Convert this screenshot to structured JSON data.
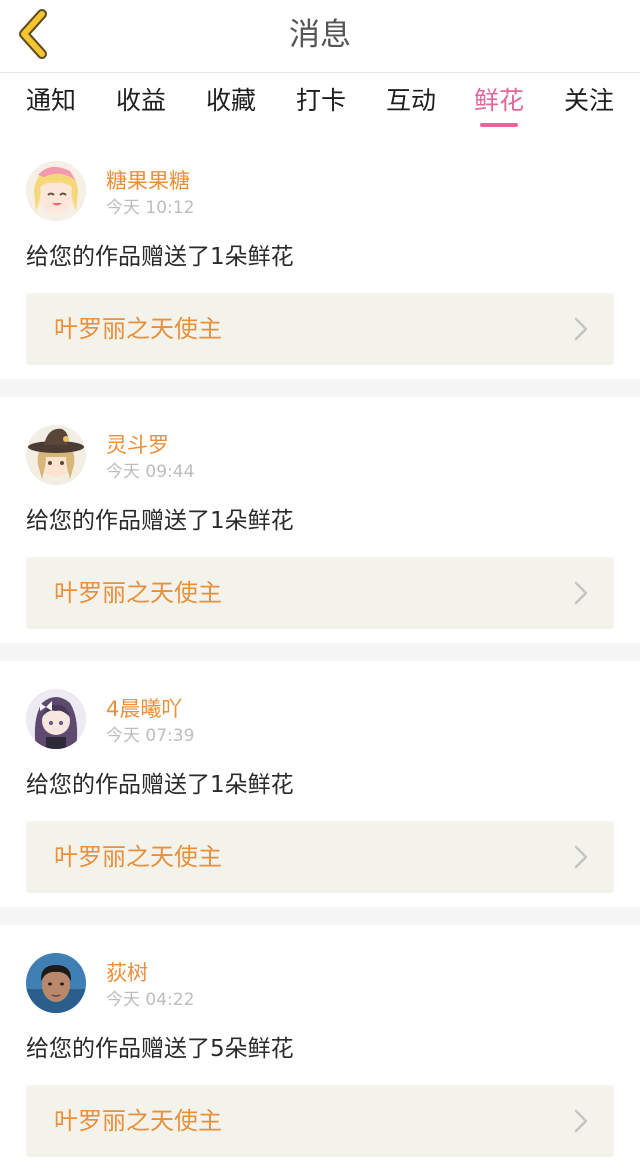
{
  "header": {
    "title": "消息"
  },
  "tabs": [
    {
      "label": "通知",
      "active": false
    },
    {
      "label": "收益",
      "active": false
    },
    {
      "label": "收藏",
      "active": false
    },
    {
      "label": "打卡",
      "active": false
    },
    {
      "label": "互动",
      "active": false
    },
    {
      "label": "鲜花",
      "active": true
    },
    {
      "label": "关注",
      "active": false
    }
  ],
  "colors": {
    "accent_pink": "#e2679c",
    "username_orange": "#ea8f3a",
    "back_arrow": "#f5c531",
    "link_background": "#f3f3ec"
  },
  "notifications": [
    {
      "username": "糖果果糖",
      "time": "今天 10:12",
      "message": "给您的作品赠送了1朵鲜花",
      "work_title": "叶罗丽之天使主",
      "avatar_icon": "anime-girl-blonde-avatar"
    },
    {
      "username": "灵斗罗",
      "time": "今天 09:44",
      "message": "给您的作品赠送了1朵鲜花",
      "work_title": "叶罗丽之天使主",
      "avatar_icon": "anime-girl-hat-avatar"
    },
    {
      "username": "4晨曦吖",
      "time": "今天 07:39",
      "message": "给您的作品赠送了1朵鲜花",
      "work_title": "叶罗丽之天使主",
      "avatar_icon": "anime-girl-purple-hair-avatar"
    },
    {
      "username": "荻树",
      "time": "今天 04:22",
      "message": "给您的作品赠送了5朵鲜花",
      "work_title": "叶罗丽之天使主",
      "avatar_icon": "user-photo-avatar"
    }
  ]
}
